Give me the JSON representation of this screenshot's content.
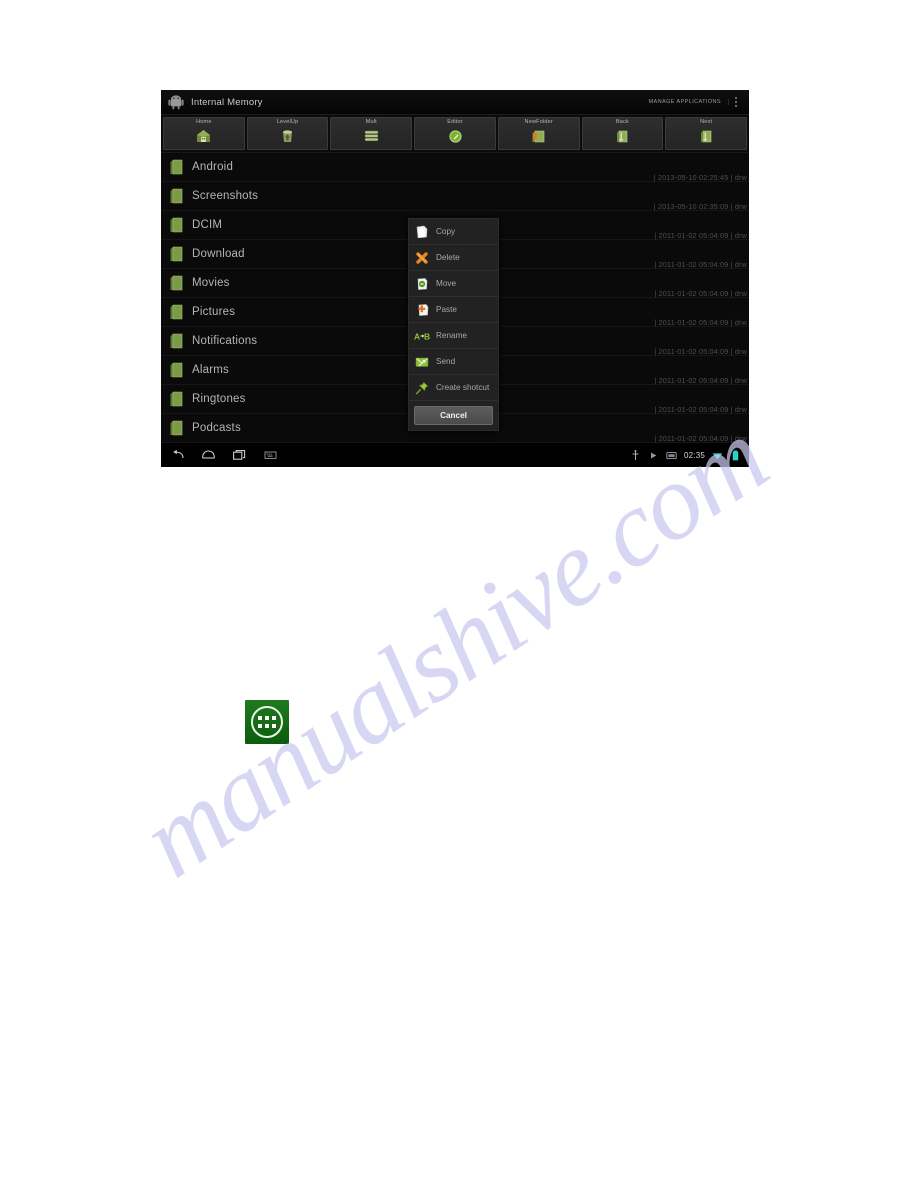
{
  "actionbar": {
    "app_icon": "android-robot-icon",
    "title": "Internal Memory",
    "manage_label": "MANAGE APPLICATIONS",
    "overflow": "overflow-menu-icon"
  },
  "toolbar": {
    "buttons": [
      {
        "label": "Home",
        "icon": "home-folder-icon"
      },
      {
        "label": "LevelUp",
        "icon": "level-up-icon"
      },
      {
        "label": "Mult",
        "icon": "multi-select-icon"
      },
      {
        "label": "Editor",
        "icon": "editor-icon"
      },
      {
        "label": "NewFolder",
        "icon": "new-folder-icon"
      },
      {
        "label": "Back",
        "icon": "back-folder-icon"
      },
      {
        "label": "Next",
        "icon": "next-folder-icon"
      }
    ]
  },
  "filelist": {
    "rows": [
      {
        "name": "Android",
        "meta": "| 2013-05-10 02:25:45 | drw"
      },
      {
        "name": "Screenshots",
        "meta": "| 2013-05-10 02:35:09 | drw"
      },
      {
        "name": "DCIM",
        "meta": "| 2011-01-02 05:04:09 | drw"
      },
      {
        "name": "Download",
        "meta": "| 2011-01-02 05:04:09 | drw"
      },
      {
        "name": "Movies",
        "meta": "| 2011-01-02 05:04:09 | drw"
      },
      {
        "name": "Pictures",
        "meta": "| 2011-01-02 05:04:09 | drw"
      },
      {
        "name": "Notifications",
        "meta": "| 2011-01-02 05:04:09 | drw"
      },
      {
        "name": "Alarms",
        "meta": "| 2011-01-02 05:04:09 | drw"
      },
      {
        "name": "Ringtones",
        "meta": "| 2011-01-02 05:04:09 | drw"
      },
      {
        "name": "Podcasts",
        "meta": "| 2011-01-02 05:04:09 | drw"
      }
    ]
  },
  "contextmenu": {
    "items": [
      {
        "label": "Copy",
        "icon": "copy-page-icon"
      },
      {
        "label": "Delete",
        "icon": "delete-x-icon"
      },
      {
        "label": "Move",
        "icon": "move-icon"
      },
      {
        "label": "Paste",
        "icon": "paste-plus-icon"
      },
      {
        "label": "Rename",
        "icon": "rename-ab-icon"
      },
      {
        "label": "Send",
        "icon": "send-icon"
      },
      {
        "label": "Create shotcut",
        "icon": "pushpin-icon"
      }
    ],
    "cancel_label": "Cancel"
  },
  "navbar": {
    "buttons": [
      {
        "icon": "back-arrow-icon"
      },
      {
        "icon": "home-icon"
      },
      {
        "icon": "recents-icon"
      },
      {
        "icon": "keyboard-icon"
      }
    ],
    "status": {
      "icons": [
        "usb-icon",
        "play-icon",
        "sdcard-icon"
      ],
      "clock": "02:35",
      "wifi": "wifi-icon",
      "battery": "battery-icon"
    }
  },
  "drawer": {
    "icon": "app-drawer-icon"
  },
  "watermark": {
    "text": "manualshive.com"
  },
  "colors": {
    "accent_green": "#7fb135",
    "accent_orange": "#e8861e",
    "screen_bg": "#0a0a0a",
    "menu_bg": "#222222",
    "watermark": "#c9c9ef"
  }
}
